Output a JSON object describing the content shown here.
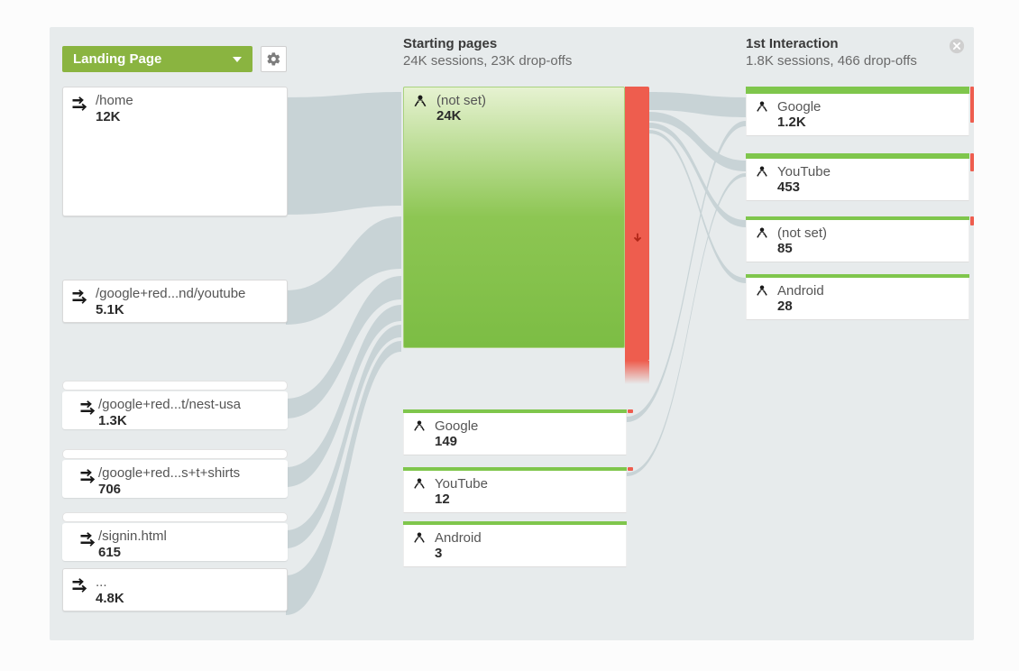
{
  "dimension_selector": {
    "label": "Landing Page"
  },
  "columns": {
    "starting": {
      "title": "Starting pages",
      "sub": "24K sessions, 23K drop-offs"
    },
    "first": {
      "title": "1st Interaction",
      "sub": "1.8K sessions, 466 drop-offs"
    }
  },
  "landing_pages": [
    {
      "path": "/home",
      "value": "12K"
    },
    {
      "path": "/google+red...nd/youtube",
      "value": "5.1K"
    },
    {
      "path": "/google+red...t/nest-usa",
      "value": "1.3K"
    },
    {
      "path": "/google+red...s+t+shirts",
      "value": "706"
    },
    {
      "path": "/signin.html",
      "value": "615"
    },
    {
      "path": "...",
      "value": "4.8K"
    }
  ],
  "starting_pages": [
    {
      "path": "(not set)",
      "value": "24K"
    },
    {
      "path": "Google",
      "value": "149"
    },
    {
      "path": "YouTube",
      "value": "12"
    },
    {
      "path": "Android",
      "value": "3"
    }
  ],
  "first_interaction": [
    {
      "path": "Google",
      "value": "1.2K"
    },
    {
      "path": "YouTube",
      "value": "453"
    },
    {
      "path": "(not set)",
      "value": "85"
    },
    {
      "path": "Android",
      "value": "28"
    }
  ]
}
